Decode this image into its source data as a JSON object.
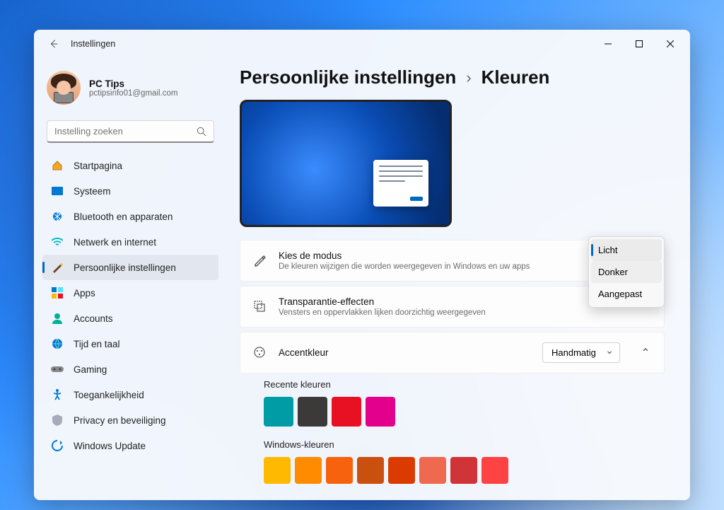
{
  "window": {
    "title": "Instellingen"
  },
  "profile": {
    "name": "PC Tips",
    "email": "pctipsinfo01@gmail.com"
  },
  "search": {
    "placeholder": "Instelling zoeken"
  },
  "nav": {
    "home": "Startpagina",
    "system": "Systeem",
    "bluetooth": "Bluetooth en apparaten",
    "network": "Netwerk en internet",
    "personalization": "Persoonlijke instellingen",
    "apps": "Apps",
    "accounts": "Accounts",
    "time": "Tijd en taal",
    "gaming": "Gaming",
    "accessibility": "Toegankelijkheid",
    "privacy": "Privacy en beveiliging",
    "update": "Windows Update"
  },
  "breadcrumb": {
    "parent": "Persoonlijke instellingen",
    "current": "Kleuren"
  },
  "mode": {
    "title": "Kies de modus",
    "desc": "De kleuren wijzigen die worden weergegeven in Windows en uw apps",
    "options": {
      "light": "Licht",
      "dark": "Donker",
      "custom": "Aangepast"
    }
  },
  "transparency": {
    "title": "Transparantie-effecten",
    "desc": "Vensters en oppervlakken lijken doorzichtig weergegeven"
  },
  "accent": {
    "title": "Accentkleur",
    "value": "Handmatig"
  },
  "recent": {
    "label": "Recente kleuren",
    "colors": [
      "#009ca6",
      "#3b3a39",
      "#e81123",
      "#e3008c"
    ]
  },
  "windows_colors": {
    "label": "Windows-kleuren",
    "colors": [
      "#ffb900",
      "#ff8c00",
      "#f7630c",
      "#ca5010",
      "#da3b01",
      "#ef6950",
      "#d13438",
      "#ff4343"
    ]
  }
}
